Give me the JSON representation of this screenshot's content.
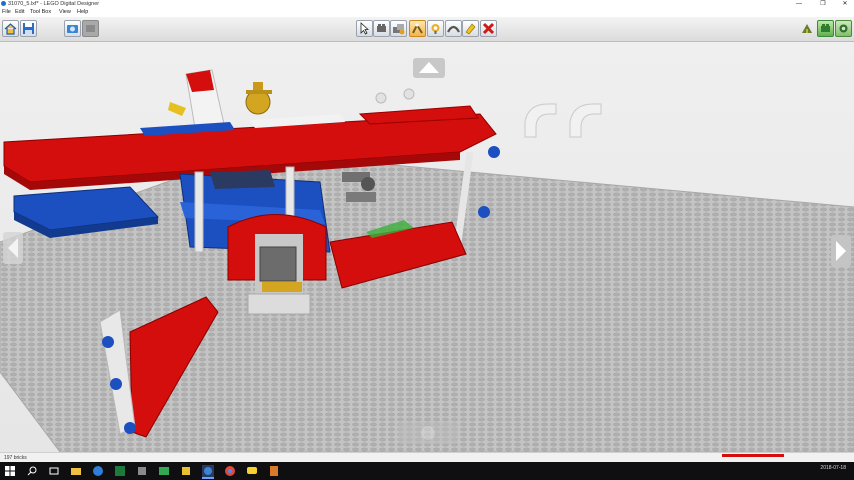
{
  "window": {
    "title": "31070_5.lxf* - LEGO Digital Designer",
    "controls": [
      "—",
      "❐",
      "✕"
    ]
  },
  "menu": [
    "File",
    "Edit",
    "Tool Box",
    "View",
    "Help"
  ],
  "toolbar": {
    "left_buttons": [
      "home-icon",
      "save-icon",
      "camera-icon",
      "camera-disabled-icon"
    ],
    "tools": [
      "select-arrow-icon",
      "multi-select-icon",
      "clone-icon",
      "hinge-icon",
      "hinge-align-icon",
      "flex-icon",
      "paint-icon",
      "hide-icon",
      "delete-icon"
    ],
    "active_tool": "hinge-icon",
    "right_buttons": [
      "building-guide-icon",
      "mode-build-icon",
      "mode-view-icon"
    ]
  },
  "status": {
    "brick_count": "197 bricks"
  },
  "taskbar": {
    "date": "2018-07-18"
  },
  "colors": {
    "lego_red": "#d40d0d",
    "lego_blue": "#1c4fc0",
    "lego_white": "#f5f5f5",
    "lego_gray": "#8a8a8a",
    "baseplate": "#bdbdbd"
  }
}
